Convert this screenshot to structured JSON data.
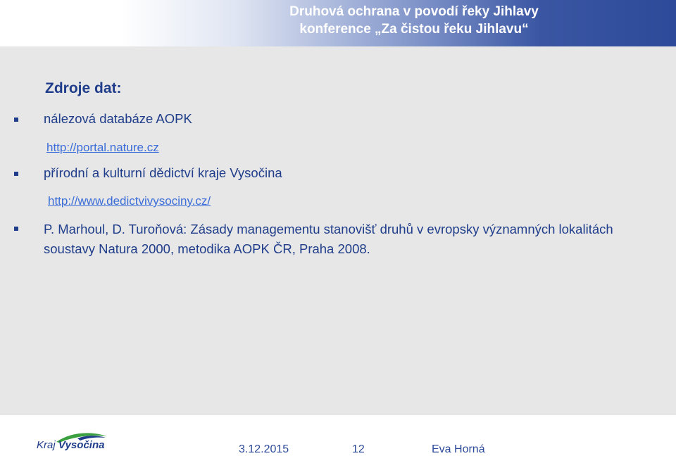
{
  "header": {
    "title_line1": "Druhová ochrana v povodí řeky Jihlavy",
    "title_line2": "konference „Za čistou řeku Jihlavu“"
  },
  "main": {
    "section_title": "Zdroje dat:",
    "items": [
      {
        "text": "nálezová databáze AOPK",
        "link": "http://portal.nature.cz"
      },
      {
        "text": "přírodní a kulturní dědictví kraje Vysočina",
        "link": "http://www.dedictvivysociny.cz/"
      }
    ],
    "reference": "P. Marhoul, D. Turoňová: Zásady managementu stanovišť druhů v evropsky významných lokalitách soustavy Natura 2000, metodika AOPK ČR, Praha 2008."
  },
  "footer": {
    "logo_part1": "Kraj",
    "logo_part2": "Vysočina",
    "date": "3.12.2015",
    "page_number": "12",
    "author": "Eva Horná"
  },
  "colors": {
    "header_blue": "#2c4a99",
    "text_blue": "#1f3d8a",
    "link_blue": "#3b6dd8",
    "logo_green": "#3aa040"
  }
}
